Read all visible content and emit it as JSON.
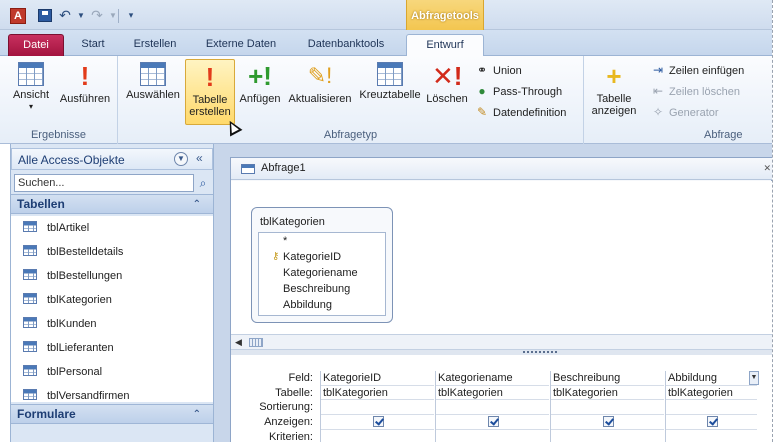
{
  "titlebar": {
    "app_icon_letter": "A",
    "context_group": "Abfragetools"
  },
  "tabs": {
    "datei": "Datei",
    "start": "Start",
    "erstellen": "Erstellen",
    "extern": "Externe Daten",
    "datenbank": "Datenbanktools",
    "entwurf": "Entwurf"
  },
  "ribbon": {
    "ergebnisse": {
      "label": "Ergebnisse",
      "ansicht": "Ansicht",
      "ausfuehren": "Ausführen"
    },
    "abfragetyp": {
      "label": "Abfragetyp",
      "auswaehlen": "Auswählen",
      "tabelle_erstellen_1": "Tabelle",
      "tabelle_erstellen_2": "erstellen",
      "anfuegen": "Anfügen",
      "aktualisieren": "Aktualisieren",
      "kreuztabelle": "Kreuztabelle",
      "loeschen": "Löschen",
      "union": "Union",
      "passthrough": "Pass-Through",
      "datendefinition": "Datendefinition"
    },
    "abfragesetup": {
      "label": "Abfrage",
      "tabelle_anzeigen_1": "Tabelle",
      "tabelle_anzeigen_2": "anzeigen",
      "zeilen_einfuegen": "Zeilen einfügen",
      "zeilen_loeschen": "Zeilen löschen",
      "generator": "Generator"
    }
  },
  "navpane": {
    "title": "Alle Access-Objekte",
    "search_placeholder": "Suchen...",
    "sections": {
      "tabellen": "Tabellen",
      "formulare": "Formulare"
    },
    "tables": [
      "tblArtikel",
      "tblBestelldetails",
      "tblBestellungen",
      "tblKategorien",
      "tblKunden",
      "tblLieferanten",
      "tblPersonal",
      "tblVersandfirmen"
    ]
  },
  "document": {
    "title": "Abfrage1",
    "fieldlist": {
      "title": "tblKategorien",
      "fields": [
        "*",
        "KategorieID",
        "Kategoriename",
        "Beschreibung",
        "Abbildung"
      ],
      "primary_key": "KategorieID"
    },
    "grid": {
      "row_labels": [
        "Feld:",
        "Tabelle:",
        "Sortierung:",
        "Anzeigen:",
        "Kriterien:"
      ],
      "columns": [
        {
          "feld": "KategorieID",
          "tabelle": "tblKategorien",
          "anzeigen": true
        },
        {
          "feld": "Kategoriename",
          "tabelle": "tblKategorien",
          "anzeigen": true
        },
        {
          "feld": "Beschreibung",
          "tabelle": "tblKategorien",
          "anzeigen": true
        },
        {
          "feld": "Abbildung",
          "tabelle": "tblKategorien",
          "anzeigen": true
        }
      ]
    }
  },
  "colors": {
    "datei_tab": "#a3143f",
    "context_tab": "#f3c650",
    "ribbon_active": "#ffd96b"
  },
  "icons": {
    "app": "access-icon",
    "save": "save-icon",
    "undo": "undo-icon",
    "redo": "redo-icon"
  }
}
